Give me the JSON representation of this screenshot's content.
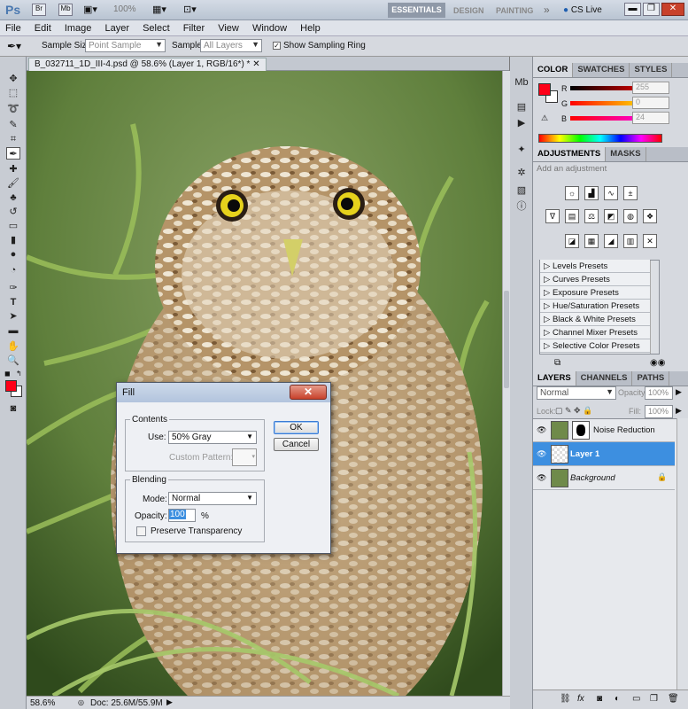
{
  "app": {
    "logo": "Ps",
    "zoom": "100%",
    "workspaces": [
      "ESSENTIALS",
      "DESIGN",
      "PAINTING"
    ],
    "more": "»",
    "cslive": "CS Live"
  },
  "menu": [
    "File",
    "Edit",
    "Image",
    "Layer",
    "Select",
    "Filter",
    "View",
    "Window",
    "Help"
  ],
  "options": {
    "sample_size_label": "Sample Size:",
    "sample_size_value": "Point Sample",
    "sample_label": "Sample:",
    "sample_value": "All Layers",
    "show_ring": "Show Sampling Ring"
  },
  "document": {
    "tab_title": "B_032711_1D_III-4.psd @ 58.6% (Layer 1, RGB/16*) *",
    "zoom": "58.6%",
    "doc_info": "Doc: 25.6M/55.9M"
  },
  "color_panel": {
    "tabs": [
      "COLOR",
      "SWATCHES",
      "STYLES"
    ],
    "channels": [
      {
        "label": "R",
        "value": "255"
      },
      {
        "label": "G",
        "value": "0"
      },
      {
        "label": "B",
        "value": "24"
      }
    ],
    "foreground": "#ff0018"
  },
  "adjustments_panel": {
    "tabs": [
      "ADJUSTMENTS",
      "MASKS"
    ],
    "hint": "Add an adjustment",
    "presets": [
      "Levels Presets",
      "Curves Presets",
      "Exposure Presets",
      "Hue/Saturation Presets",
      "Black & White Presets",
      "Channel Mixer Presets",
      "Selective Color Presets"
    ]
  },
  "layers_panel": {
    "tabs": [
      "LAYERS",
      "CHANNELS",
      "PATHS"
    ],
    "blend_mode": "Normal",
    "opacity_label": "Opacity:",
    "opacity": "100%",
    "lock_label": "Lock:",
    "fill_label": "Fill:",
    "fill": "100%",
    "layers": [
      {
        "name": "Noise Reduction",
        "selected": false
      },
      {
        "name": "Layer 1",
        "selected": true
      },
      {
        "name": "Background",
        "selected": false
      }
    ]
  },
  "fill_dialog": {
    "title": "Fill",
    "close": "✕",
    "contents_legend": "Contents",
    "use_label": "Use:",
    "use_value": "50% Gray",
    "custom_pattern_label": "Custom Pattern:",
    "blending_legend": "Blending",
    "mode_label": "Mode:",
    "mode_value": "Normal",
    "opacity_label": "Opacity:",
    "opacity_value": "100",
    "opacity_unit": "%",
    "preserve_label": "Preserve Transparency",
    "ok": "OK",
    "cancel": "Cancel"
  },
  "colors": {
    "accent": "#3d8fe0",
    "foreground_swatch": "#ff0018"
  }
}
